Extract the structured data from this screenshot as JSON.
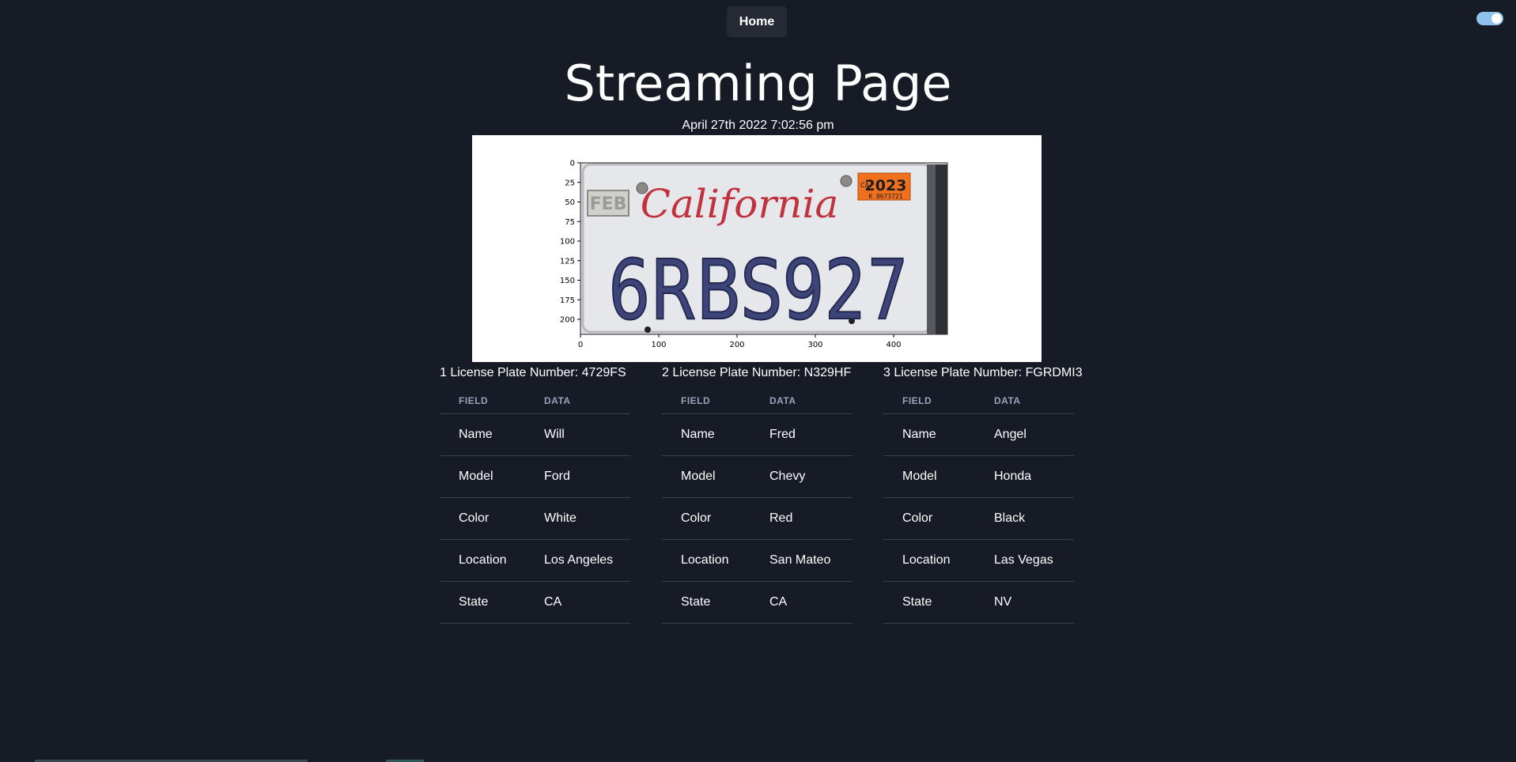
{
  "nav": {
    "home_label": "Home"
  },
  "theme_toggle": {
    "state": "on",
    "color": "#8ec4ec"
  },
  "page": {
    "title": "Streaming Page",
    "timestamp": "April 27th 2022 7:02:56 pm"
  },
  "plate_image": {
    "plate_state": "California",
    "plate_text": "6RBS927",
    "left_sticker": "FEB",
    "right_sticker_year": "2023",
    "right_sticker_side": "CA",
    "right_sticker_serial": "K 8673721",
    "y_ticks": [
      "0",
      "25",
      "50",
      "75",
      "100",
      "125",
      "150",
      "175",
      "200"
    ],
    "x_ticks": [
      "0",
      "100",
      "200",
      "300",
      "400"
    ]
  },
  "cards": [
    {
      "title": "1 License Plate Number: 4729FS",
      "headers": [
        "FIELD",
        "DATA"
      ],
      "rows": [
        [
          "Name",
          "Will"
        ],
        [
          "Model",
          "Ford"
        ],
        [
          "Color",
          "White"
        ],
        [
          "Location",
          "Los Angeles"
        ],
        [
          "State",
          "CA"
        ]
      ]
    },
    {
      "title": "2 License Plate Number: N329HF",
      "headers": [
        "FIELD",
        "DATA"
      ],
      "rows": [
        [
          "Name",
          "Fred"
        ],
        [
          "Model",
          "Chevy"
        ],
        [
          "Color",
          "Red"
        ],
        [
          "Location",
          "San Mateo"
        ],
        [
          "State",
          "CA"
        ]
      ]
    },
    {
      "title": "3 License Plate Number: FGRDMI3",
      "headers": [
        "FIELD",
        "DATA"
      ],
      "rows": [
        [
          "Name",
          "Angel"
        ],
        [
          "Model",
          "Honda"
        ],
        [
          "Color",
          "Black"
        ],
        [
          "Location",
          "Las Vegas"
        ],
        [
          "State",
          "NV"
        ]
      ]
    }
  ]
}
